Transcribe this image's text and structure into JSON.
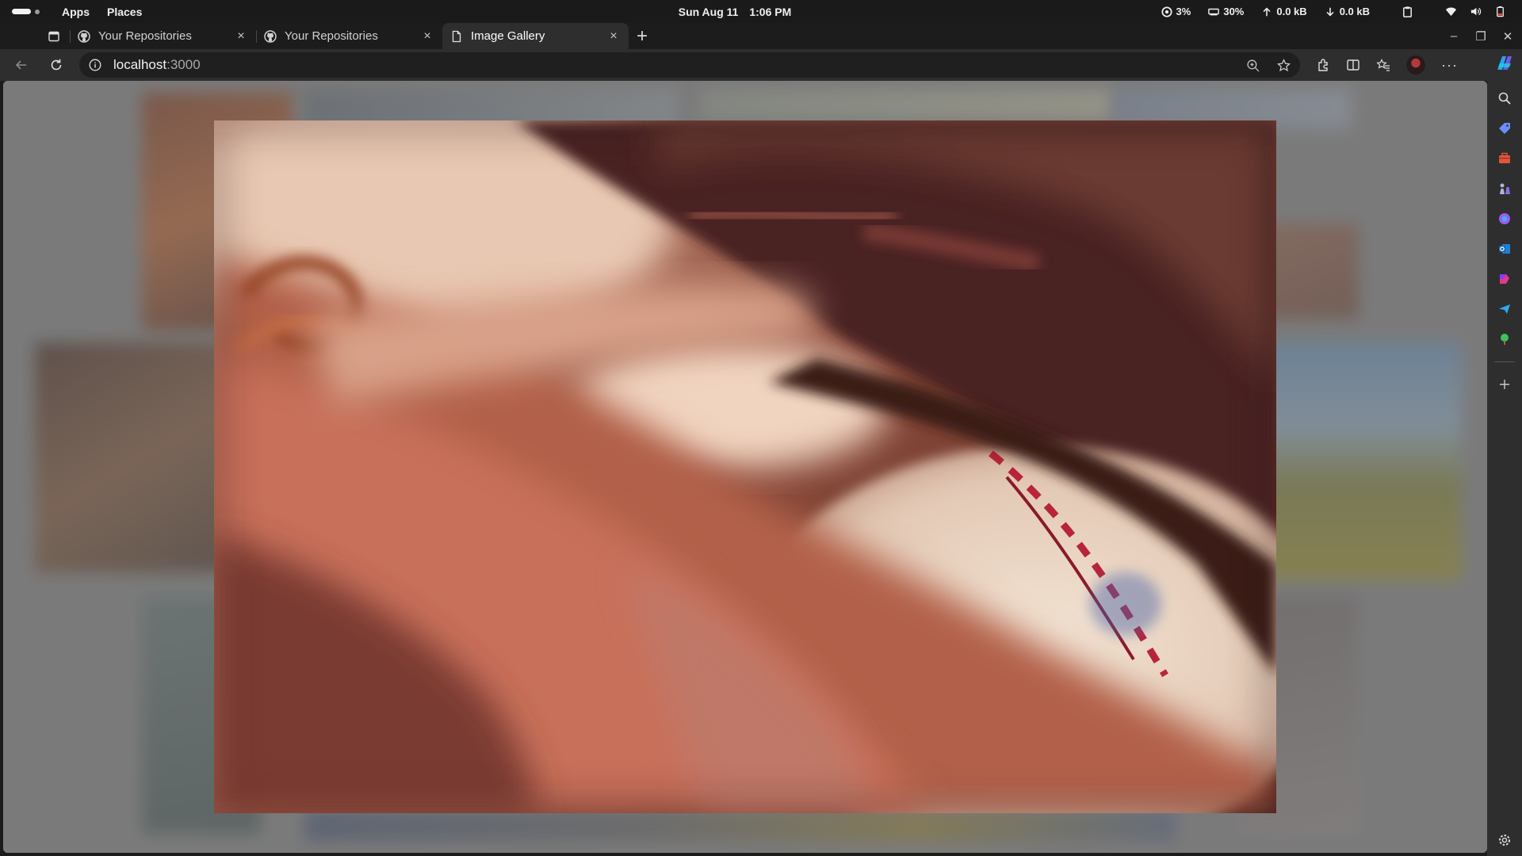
{
  "system_bar": {
    "menus": [
      "Apps",
      "Places"
    ],
    "date": "Sun Aug 11",
    "time": "1:06 PM",
    "cpu": "3%",
    "memory": "30%",
    "upload": "0.0 kB",
    "download": "0.0 kB",
    "icons": [
      "clipboard-icon",
      "wifi-icon",
      "volume-icon",
      "battery-icon"
    ]
  },
  "browser": {
    "tabs": [
      {
        "title": "Your Repositories",
        "icon": "github-icon",
        "active": false
      },
      {
        "title": "Your Repositories",
        "icon": "github-icon",
        "active": false
      },
      {
        "title": "Image Gallery",
        "icon": "page-icon",
        "active": true
      }
    ],
    "new_tab_symbol": "+",
    "address": {
      "host": "localhost",
      "port": ":3000"
    },
    "more_symbol": "···"
  },
  "page": {
    "view": "lightbox",
    "image_subject": "baseball-in-glove"
  },
  "colors": {
    "top_bar": "#1a1a1a",
    "toolbar": "#2e2e2e",
    "omnibox": "#1f1f1f",
    "overlay": "#6e6e6e"
  }
}
